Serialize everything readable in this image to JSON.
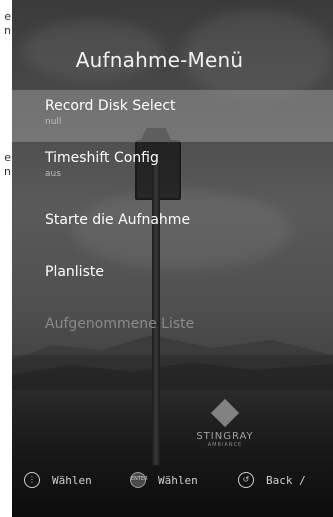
{
  "side_text": {
    "line1a": "e",
    "line1b": "n",
    "line2a": "e",
    "line2b": "n"
  },
  "title": "Aufnahme-Menü",
  "menu": {
    "items": [
      {
        "label": "Record Disk Select",
        "sub": "null",
        "selected": true
      },
      {
        "label": "Timeshift Config",
        "sub": "aus"
      },
      {
        "label": "Starte die Aufnahme"
      },
      {
        "label": "Planliste"
      },
      {
        "label": "Aufgenommene Liste",
        "disabled": true
      }
    ]
  },
  "logo": {
    "name": "STINGRAY",
    "sub": "AMBIANCE"
  },
  "hints": {
    "nav_label": "Wählen",
    "enter_icon": "ENTER",
    "enter_label": "Wählen",
    "back_label": "Back /"
  },
  "icons": {
    "nav": "dpad-icon",
    "enter": "enter-icon",
    "back": "back-icon"
  }
}
